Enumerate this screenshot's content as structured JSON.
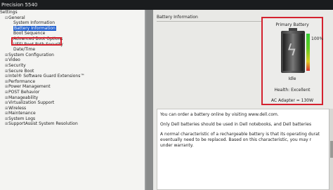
{
  "window": {
    "title": "Precision 5540"
  },
  "tree": [
    {
      "label": "Settings",
      "level": 0,
      "expand": ""
    },
    {
      "label": "General",
      "level": 1,
      "expand": "⊟"
    },
    {
      "label": "System Information",
      "level": 2,
      "expand": ""
    },
    {
      "label": "Battery Information",
      "level": 2,
      "expand": "",
      "selected": true
    },
    {
      "label": "Boot Sequence",
      "level": 2,
      "expand": ""
    },
    {
      "label": "Advanced Boot Options",
      "level": 2,
      "expand": ""
    },
    {
      "label": "UEFI Boot Path Security",
      "level": 2,
      "expand": ""
    },
    {
      "label": "Date/Time",
      "level": 2,
      "expand": ""
    },
    {
      "label": "System Configuration",
      "level": 1,
      "expand": "⊞"
    },
    {
      "label": "Video",
      "level": 1,
      "expand": "⊞"
    },
    {
      "label": "Security",
      "level": 1,
      "expand": "⊞"
    },
    {
      "label": "Secure Boot",
      "level": 1,
      "expand": "⊞"
    },
    {
      "label": "Intel® Software Guard Extensions™",
      "level": 1,
      "expand": "⊞"
    },
    {
      "label": "Performance",
      "level": 1,
      "expand": "⊞"
    },
    {
      "label": "Power Management",
      "level": 1,
      "expand": "⊞"
    },
    {
      "label": "POST Behavior",
      "level": 1,
      "expand": "⊞"
    },
    {
      "label": "Manageability",
      "level": 1,
      "expand": "⊞"
    },
    {
      "label": "Virtualization Support",
      "level": 1,
      "expand": "⊞"
    },
    {
      "label": "Wireless",
      "level": 1,
      "expand": "⊞"
    },
    {
      "label": "Maintenance",
      "level": 1,
      "expand": "⊞"
    },
    {
      "label": "System Logs",
      "level": 1,
      "expand": "⊞"
    },
    {
      "label": "SupportAssist System Resolution",
      "level": 1,
      "expand": "⊞"
    }
  ],
  "main": {
    "section_title": "Battery Information",
    "battery": {
      "title": "Primary Battery",
      "percent_high": "100%",
      "percent_low": "0%",
      "charge_level": 1.0,
      "state": "Idle",
      "health": "Health: Excellent",
      "adapter": "AC Adapter = 130W"
    },
    "info_lines": [
      "You can order a battery online by visiting www.dell.com.",
      "",
      "Only Dell batteries should be used in Dell notebooks, and Dell batteries",
      "",
      "A normal characteristic of a rechargeable battery is that its operating durat",
      "eventually need to be replaced.  Based on this characteristic, you may r",
      "under warranty."
    ]
  }
}
